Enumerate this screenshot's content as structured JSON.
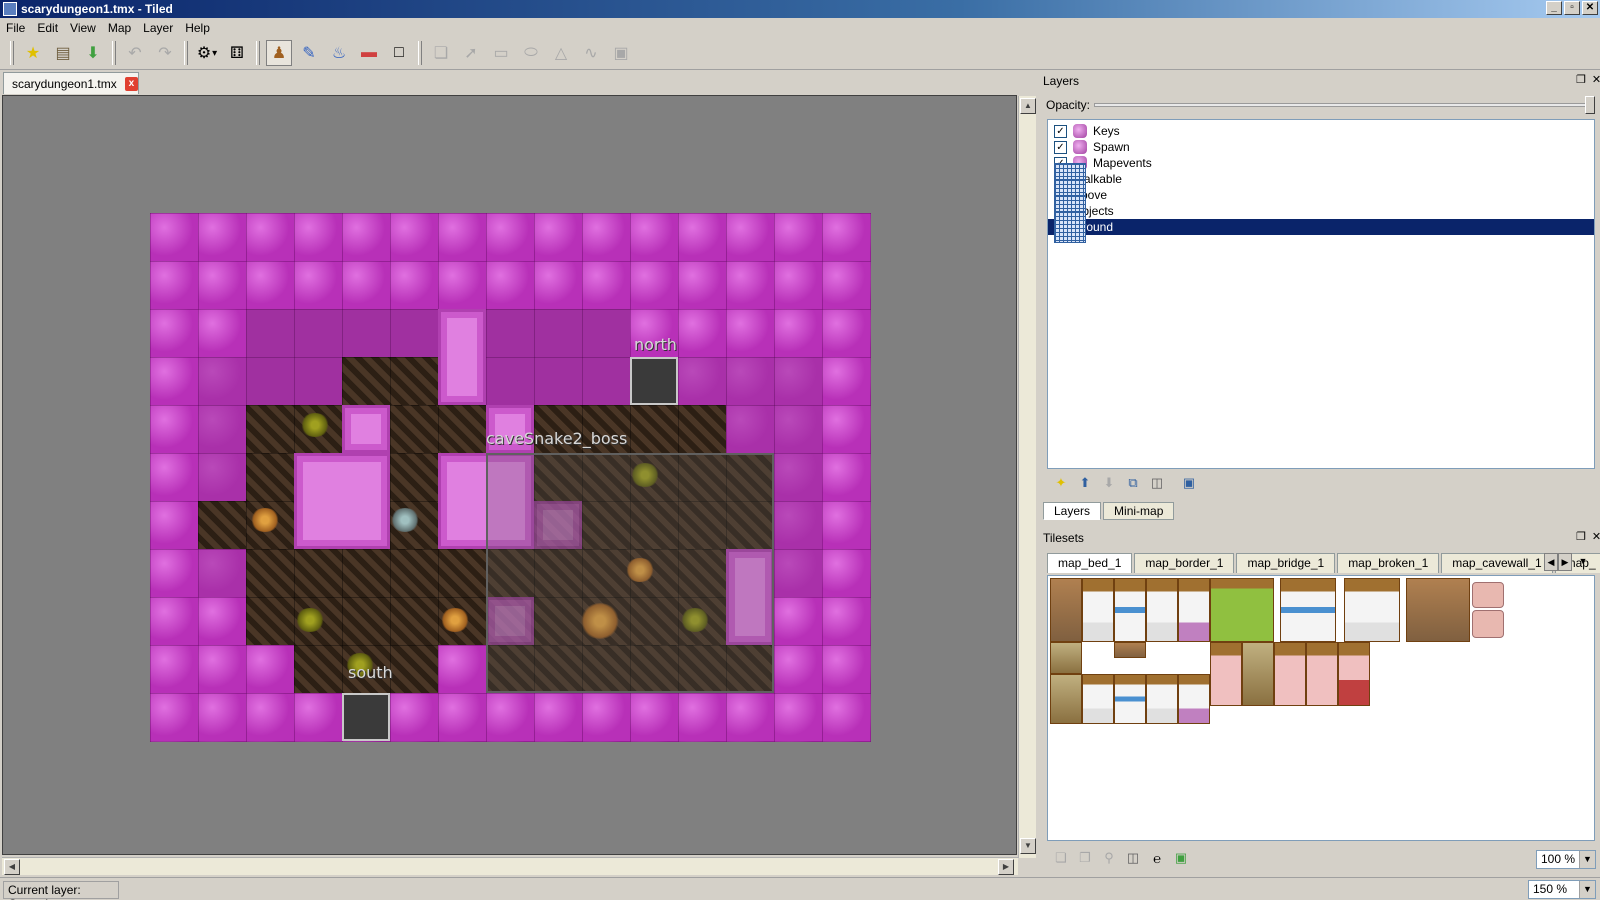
{
  "window": {
    "title": "scarydungeon1.tmx - Tiled",
    "min": "_",
    "max": "▫",
    "close": "✕"
  },
  "menu": [
    "File",
    "Edit",
    "View",
    "Map",
    "Layer",
    "Help"
  ],
  "toolbar": {
    "icons": [
      "new-icon",
      "open-icon",
      "save-icon",
      "undo-icon",
      "redo-icon",
      "commands-icon",
      "random-icon",
      "stamp-brush-icon",
      "terrain-brush-icon",
      "bucket-fill-icon",
      "eraser-icon",
      "rect-select-icon",
      "select-objects-icon",
      "edit-polygons-icon",
      "insert-rectangle-icon",
      "insert-ellipse-icon",
      "insert-polygon-icon",
      "insert-polyline-icon",
      "insert-tile-icon"
    ]
  },
  "document": {
    "tab_label": "scarydungeon1.tmx",
    "close": "x"
  },
  "map": {
    "objects": [
      {
        "label": "north"
      },
      {
        "label": "caveSnake2_boss"
      },
      {
        "label": "south"
      }
    ]
  },
  "status": {
    "current_layer": "Current layer: Ground",
    "zoom": "150 %"
  },
  "layers_panel": {
    "title": "Layers",
    "opacity_label": "Opacity:",
    "opacity": 1.0,
    "layers": [
      {
        "name": "Keys",
        "type": "object",
        "visible": true,
        "selected": false
      },
      {
        "name": "Spawn",
        "type": "object",
        "visible": true,
        "selected": false
      },
      {
        "name": "Mapevents",
        "type": "object",
        "visible": true,
        "selected": false
      },
      {
        "name": "Walkable",
        "type": "tile",
        "visible": true,
        "selected": false
      },
      {
        "name": "Above",
        "type": "tile",
        "visible": true,
        "selected": false
      },
      {
        "name": "Objects",
        "type": "tile",
        "visible": true,
        "selected": false
      },
      {
        "name": "Ground",
        "type": "tile",
        "visible": true,
        "selected": true
      }
    ],
    "tabs": [
      "Layers",
      "Mini-map"
    ]
  },
  "tilesets_panel": {
    "title": "Tilesets",
    "tabs": [
      "map_bed_1",
      "map_border_1",
      "map_bridge_1",
      "map_broken_1",
      "map_cavewall_1",
      "map_"
    ],
    "zoom": "100 %"
  },
  "colors": {
    "accent": "#0a246a",
    "map_wall": "#c040c0",
    "map_floor": "#3a2a1c"
  }
}
